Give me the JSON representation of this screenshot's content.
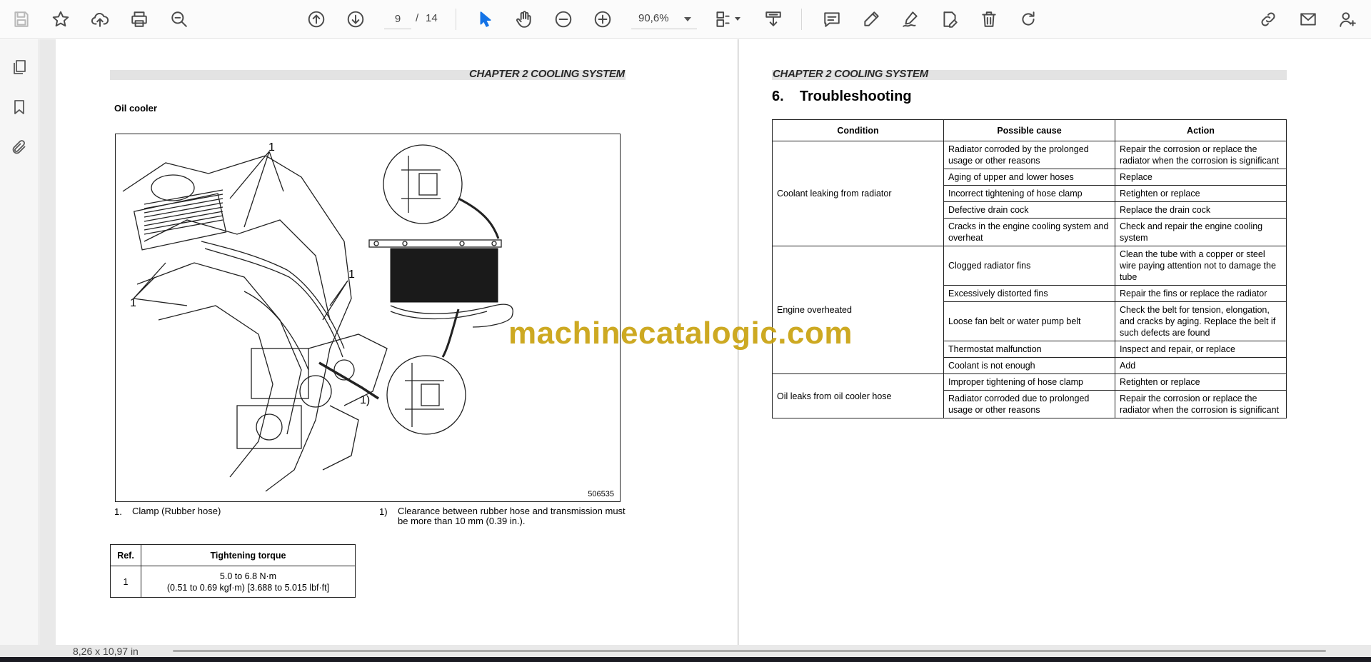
{
  "toolbar": {
    "page_current": "9",
    "page_separator": "/",
    "page_total": "14",
    "zoom": "90,6%"
  },
  "status": {
    "page_size": "8,26 x 10,97 in"
  },
  "left_page": {
    "chapter": "CHAPTER 2 COOLING SYSTEM",
    "section_heading": "Oil cooler",
    "figure_code": "506535",
    "figure_callouts": [
      "1",
      "1",
      "1",
      "1)"
    ],
    "legend": [
      {
        "num": "1.",
        "text": "Clamp (Rubber hose)"
      },
      {
        "num": "1)",
        "text": "Clearance between rubber hose and transmission must be more than 10 mm (0.39 in.)."
      }
    ],
    "torque_table": {
      "headers": [
        "Ref.",
        "Tightening torque"
      ],
      "rows": [
        {
          "ref": "1",
          "line1": "5.0 to 6.8 N·m",
          "line2": "(0.51 to 0.69 kgf·m) [3.688 to 5.015 lbf·ft]"
        }
      ]
    }
  },
  "right_page": {
    "chapter": "CHAPTER 2 COOLING SYSTEM",
    "heading": "6.    Troubleshooting",
    "table": {
      "headers": [
        "Condition",
        "Possible cause",
        "Action"
      ],
      "groups": [
        {
          "condition": "Coolant leaking from radiator",
          "rows": [
            {
              "cause": "Radiator corroded by the prolonged usage or other reasons",
              "action": "Repair the corrosion or replace the radiator when the corrosion is significant"
            },
            {
              "cause": "Aging of upper and lower hoses",
              "action": "Replace"
            },
            {
              "cause": "Incorrect tightening of hose clamp",
              "action": "Retighten or replace"
            },
            {
              "cause": "Defective drain cock",
              "action": "Replace the drain cock"
            },
            {
              "cause": "Cracks in the engine cooling system and overheat",
              "action": "Check and repair the engine cooling system"
            }
          ]
        },
        {
          "condition": "Engine overheated",
          "rows": [
            {
              "cause": "Clogged radiator fins",
              "action": "Clean the tube with a copper or steel wire paying attention not to damage the tube"
            },
            {
              "cause": "Excessively distorted fins",
              "action": "Repair the fins or replace the radiator"
            },
            {
              "cause": "Loose fan belt or water pump belt",
              "action": "Check the belt for tension, elongation, and cracks by aging. Replace the belt if such defects are found"
            },
            {
              "cause": "Thermostat malfunction",
              "action": "Inspect and repair, or replace"
            },
            {
              "cause": "Coolant is not enough",
              "action": "Add"
            }
          ]
        },
        {
          "condition": "Oil leaks from oil cooler hose",
          "rows": [
            {
              "cause": "Improper tightening of hose clamp",
              "action": "Retighten or replace"
            },
            {
              "cause": "Radiator corroded due to prolonged usage or other reasons",
              "action": "Repair the corrosion or replace the radiator when the corrosion is significant"
            }
          ]
        }
      ]
    }
  },
  "watermark": "machinecatalogic.com",
  "icons": {
    "toolbar": [
      "save-icon",
      "bookmark-star-icon",
      "cloud-upload-icon",
      "print-icon",
      "zoom-search-icon",
      "page-up-icon",
      "page-down-icon",
      "select-cursor-icon",
      "hand-pan-icon",
      "zoom-out-icon",
      "zoom-in-icon",
      "page-layout-icon",
      "download-tray-icon",
      "comment-icon",
      "highlight-pen-icon",
      "sign-icon",
      "edit-document-icon",
      "delete-icon",
      "redo-icon",
      "share-link-icon",
      "email-icon",
      "add-user-icon"
    ],
    "sidebar": [
      "pages-icon",
      "bookmarks-icon",
      "attachments-icon"
    ]
  },
  "colors": {
    "accent": "#1473e6",
    "watermark": "#c8a00a"
  }
}
